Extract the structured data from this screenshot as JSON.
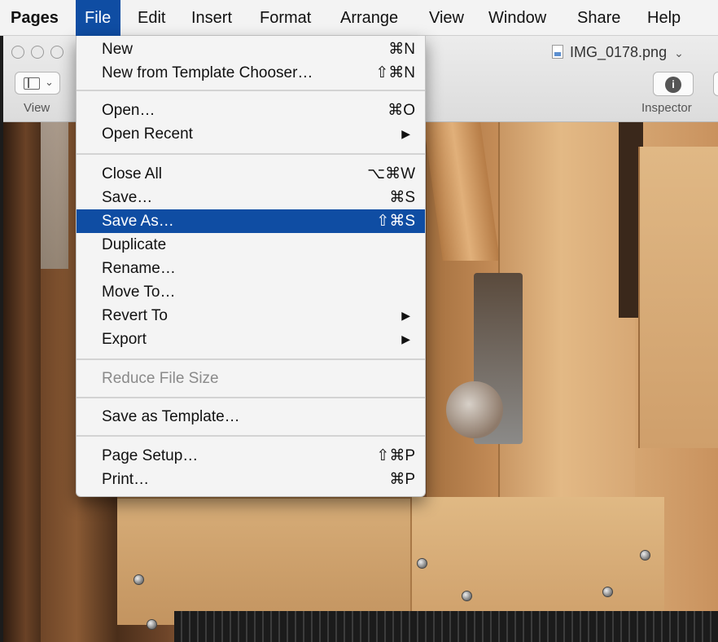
{
  "menubar": {
    "app": "Pages",
    "items": [
      "File",
      "Edit",
      "Insert",
      "Format",
      "Arrange",
      "View",
      "Window",
      "Share",
      "Help"
    ]
  },
  "toolbar": {
    "view_label": "View",
    "document_title": "IMG_0178.png",
    "inspector_label": "Inspector"
  },
  "file_menu": {
    "new": {
      "label": "New",
      "shortcut": "⌘N"
    },
    "new_template": {
      "label": "New from Template Chooser…",
      "shortcut": "⇧⌘N"
    },
    "open": {
      "label": "Open…",
      "shortcut": "⌘O"
    },
    "open_recent": {
      "label": "Open Recent"
    },
    "close_all": {
      "label": "Close All",
      "shortcut": "⌥⌘W"
    },
    "save": {
      "label": "Save…",
      "shortcut": "⌘S"
    },
    "save_as": {
      "label": "Save As…",
      "shortcut": "⇧⌘S"
    },
    "duplicate": {
      "label": "Duplicate"
    },
    "rename": {
      "label": "Rename…"
    },
    "move_to": {
      "label": "Move To…"
    },
    "revert_to": {
      "label": "Revert To"
    },
    "export": {
      "label": "Export"
    },
    "reduce_file_size": {
      "label": "Reduce File Size"
    },
    "save_as_template": {
      "label": "Save as Template…"
    },
    "page_setup": {
      "label": "Page Setup…",
      "shortcut": "⇧⌘P"
    },
    "print": {
      "label": "Print…",
      "shortcut": "⌘P"
    }
  },
  "colors": {
    "highlight": "#0f4da3",
    "menu_bg": "#f4f4f4",
    "disabled_text": "#8a8a8a"
  },
  "icons": {
    "submenu": "chevron-right-icon",
    "inspector": "info-icon",
    "view": "sidebar-icon",
    "file": "png-file-icon"
  }
}
